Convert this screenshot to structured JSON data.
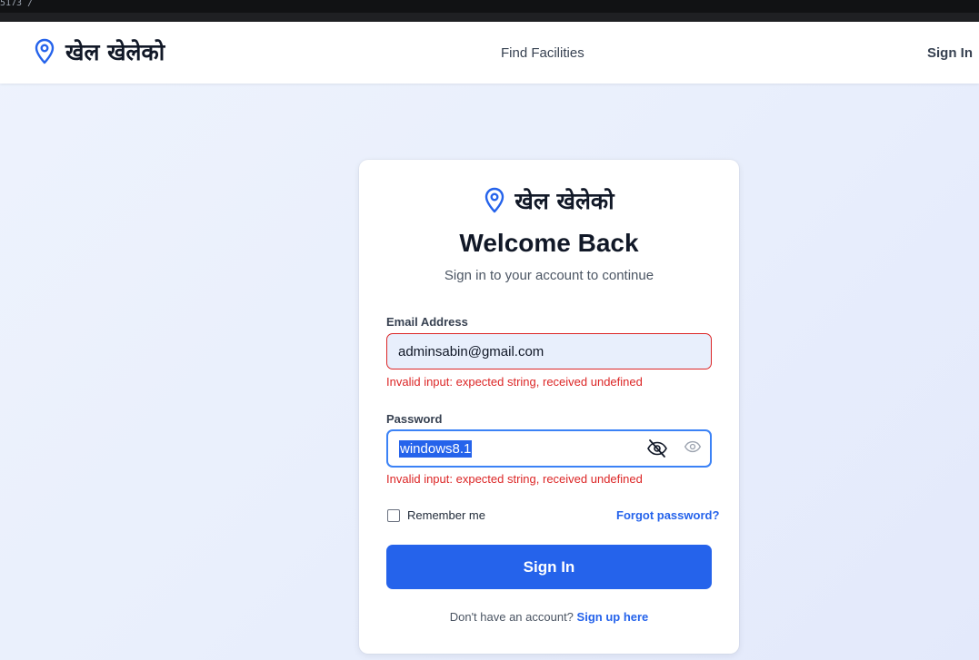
{
  "topbar": {
    "tab_text": "5173  /"
  },
  "navbar": {
    "brand_name": "खेल खेलेको",
    "find_facilities": "Find Facilities",
    "sign_in": "Sign In"
  },
  "card": {
    "brand_name": "खेल खेलेको",
    "title": "Welcome Back",
    "subtitle": "Sign in to your account to continue",
    "email": {
      "label": "Email Address",
      "value": "adminsabin@gmail.com",
      "error": "Invalid input: expected string, received undefined"
    },
    "password": {
      "label": "Password",
      "value": "windows8.1",
      "error": "Invalid input: expected string, received undefined"
    },
    "remember_me": "Remember me",
    "forgot_password": "Forgot password?",
    "submit": "Sign In",
    "footer": {
      "prompt": "Don't have an account?",
      "link": "Sign up here"
    }
  },
  "colors": {
    "accent": "#2563eb",
    "error": "#dc2626",
    "brand_icon": "#2563eb"
  },
  "icons": [
    "map-pin-icon",
    "eye-slash-icon",
    "eye-icon"
  ]
}
